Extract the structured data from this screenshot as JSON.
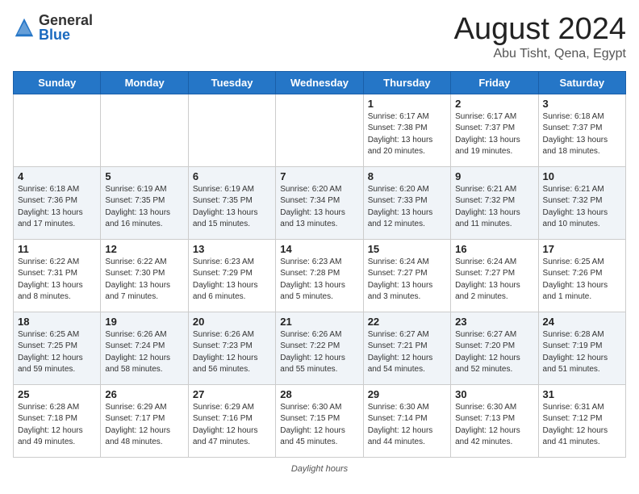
{
  "header": {
    "logo_general": "General",
    "logo_blue": "Blue",
    "title": "August 2024",
    "location": "Abu Tisht, Qena, Egypt"
  },
  "weekdays": [
    "Sunday",
    "Monday",
    "Tuesday",
    "Wednesday",
    "Thursday",
    "Friday",
    "Saturday"
  ],
  "weeks": [
    [
      {
        "day": "",
        "info": ""
      },
      {
        "day": "",
        "info": ""
      },
      {
        "day": "",
        "info": ""
      },
      {
        "day": "",
        "info": ""
      },
      {
        "day": "1",
        "info": "Sunrise: 6:17 AM\nSunset: 7:38 PM\nDaylight: 13 hours and 20 minutes."
      },
      {
        "day": "2",
        "info": "Sunrise: 6:17 AM\nSunset: 7:37 PM\nDaylight: 13 hours and 19 minutes."
      },
      {
        "day": "3",
        "info": "Sunrise: 6:18 AM\nSunset: 7:37 PM\nDaylight: 13 hours and 18 minutes."
      }
    ],
    [
      {
        "day": "4",
        "info": "Sunrise: 6:18 AM\nSunset: 7:36 PM\nDaylight: 13 hours and 17 minutes."
      },
      {
        "day": "5",
        "info": "Sunrise: 6:19 AM\nSunset: 7:35 PM\nDaylight: 13 hours and 16 minutes."
      },
      {
        "day": "6",
        "info": "Sunrise: 6:19 AM\nSunset: 7:35 PM\nDaylight: 13 hours and 15 minutes."
      },
      {
        "day": "7",
        "info": "Sunrise: 6:20 AM\nSunset: 7:34 PM\nDaylight: 13 hours and 13 minutes."
      },
      {
        "day": "8",
        "info": "Sunrise: 6:20 AM\nSunset: 7:33 PM\nDaylight: 13 hours and 12 minutes."
      },
      {
        "day": "9",
        "info": "Sunrise: 6:21 AM\nSunset: 7:32 PM\nDaylight: 13 hours and 11 minutes."
      },
      {
        "day": "10",
        "info": "Sunrise: 6:21 AM\nSunset: 7:32 PM\nDaylight: 13 hours and 10 minutes."
      }
    ],
    [
      {
        "day": "11",
        "info": "Sunrise: 6:22 AM\nSunset: 7:31 PM\nDaylight: 13 hours and 8 minutes."
      },
      {
        "day": "12",
        "info": "Sunrise: 6:22 AM\nSunset: 7:30 PM\nDaylight: 13 hours and 7 minutes."
      },
      {
        "day": "13",
        "info": "Sunrise: 6:23 AM\nSunset: 7:29 PM\nDaylight: 13 hours and 6 minutes."
      },
      {
        "day": "14",
        "info": "Sunrise: 6:23 AM\nSunset: 7:28 PM\nDaylight: 13 hours and 5 minutes."
      },
      {
        "day": "15",
        "info": "Sunrise: 6:24 AM\nSunset: 7:27 PM\nDaylight: 13 hours and 3 minutes."
      },
      {
        "day": "16",
        "info": "Sunrise: 6:24 AM\nSunset: 7:27 PM\nDaylight: 13 hours and 2 minutes."
      },
      {
        "day": "17",
        "info": "Sunrise: 6:25 AM\nSunset: 7:26 PM\nDaylight: 13 hours and 1 minute."
      }
    ],
    [
      {
        "day": "18",
        "info": "Sunrise: 6:25 AM\nSunset: 7:25 PM\nDaylight: 12 hours and 59 minutes."
      },
      {
        "day": "19",
        "info": "Sunrise: 6:26 AM\nSunset: 7:24 PM\nDaylight: 12 hours and 58 minutes."
      },
      {
        "day": "20",
        "info": "Sunrise: 6:26 AM\nSunset: 7:23 PM\nDaylight: 12 hours and 56 minutes."
      },
      {
        "day": "21",
        "info": "Sunrise: 6:26 AM\nSunset: 7:22 PM\nDaylight: 12 hours and 55 minutes."
      },
      {
        "day": "22",
        "info": "Sunrise: 6:27 AM\nSunset: 7:21 PM\nDaylight: 12 hours and 54 minutes."
      },
      {
        "day": "23",
        "info": "Sunrise: 6:27 AM\nSunset: 7:20 PM\nDaylight: 12 hours and 52 minutes."
      },
      {
        "day": "24",
        "info": "Sunrise: 6:28 AM\nSunset: 7:19 PM\nDaylight: 12 hours and 51 minutes."
      }
    ],
    [
      {
        "day": "25",
        "info": "Sunrise: 6:28 AM\nSunset: 7:18 PM\nDaylight: 12 hours and 49 minutes."
      },
      {
        "day": "26",
        "info": "Sunrise: 6:29 AM\nSunset: 7:17 PM\nDaylight: 12 hours and 48 minutes."
      },
      {
        "day": "27",
        "info": "Sunrise: 6:29 AM\nSunset: 7:16 PM\nDaylight: 12 hours and 47 minutes."
      },
      {
        "day": "28",
        "info": "Sunrise: 6:30 AM\nSunset: 7:15 PM\nDaylight: 12 hours and 45 minutes."
      },
      {
        "day": "29",
        "info": "Sunrise: 6:30 AM\nSunset: 7:14 PM\nDaylight: 12 hours and 44 minutes."
      },
      {
        "day": "30",
        "info": "Sunrise: 6:30 AM\nSunset: 7:13 PM\nDaylight: 12 hours and 42 minutes."
      },
      {
        "day": "31",
        "info": "Sunrise: 6:31 AM\nSunset: 7:12 PM\nDaylight: 12 hours and 41 minutes."
      }
    ]
  ],
  "footer": {
    "label": "Daylight hours"
  }
}
